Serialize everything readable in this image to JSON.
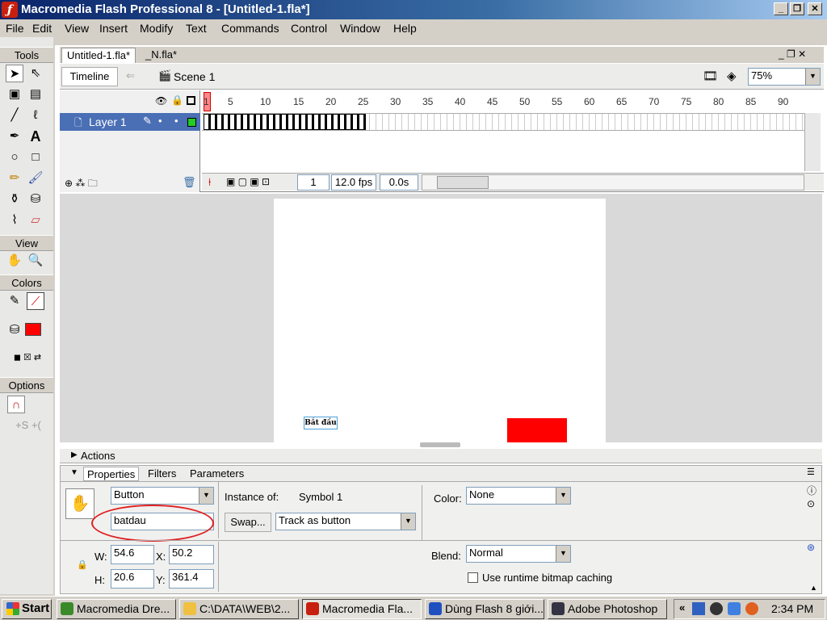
{
  "window": {
    "title": "Macromedia Flash Professional 8 - [Untitled-1.fla*]",
    "min": "_",
    "max": "❐",
    "close": "✕"
  },
  "menu": [
    "File",
    "Edit",
    "View",
    "Insert",
    "Modify",
    "Text",
    "Commands",
    "Control",
    "Window",
    "Help"
  ],
  "tools": {
    "header": "Tools",
    "view": "View",
    "colors": "Colors",
    "options": "Options"
  },
  "tabs": [
    "Untitled-1.fla*",
    "_N.fla*"
  ],
  "editbar": {
    "timeline": "Timeline",
    "scene": "Scene 1",
    "zoom": "75%"
  },
  "timeline": {
    "layer": "Layer 1",
    "ruler": [
      "1",
      "5",
      "10",
      "15",
      "20",
      "25",
      "30",
      "35",
      "40",
      "45",
      "50",
      "55",
      "60",
      "65",
      "70",
      "75",
      "80",
      "85",
      "90"
    ],
    "current_frame": "1",
    "fps": "12.0 fps",
    "time": "0.0s"
  },
  "stage": {
    "button_text": "Bắt đầu"
  },
  "panels": {
    "actions": "Actions",
    "properties": "Properties",
    "filters": "Filters",
    "parameters": "Parameters"
  },
  "properties": {
    "symbol_type": "Button",
    "instance_name": "batdau",
    "instance_of_label": "Instance of:",
    "instance_of": "Symbol 1",
    "swap": "Swap...",
    "track": "Track as button",
    "color_label": "Color:",
    "color": "None",
    "w_label": "W:",
    "w": "54.6",
    "h_label": "H:",
    "h": "20.6",
    "x_label": "X:",
    "x": "50.2",
    "y_label": "Y:",
    "y": "361.4",
    "blend_label": "Blend:",
    "blend": "Normal",
    "cache_label": "Use runtime bitmap caching"
  },
  "taskbar": {
    "start": "Start",
    "tasks": [
      "Macromedia Dre...",
      "C:\\DATA\\WEB\\2...",
      "Macromedia Fla...",
      "Dùng Flash 8 giới...",
      "Adobe Photoshop"
    ],
    "clock": "2:34 PM"
  },
  "colors": {
    "fill": "#ff0000",
    "title_start": "#0a246a",
    "title_end": "#a6caf0",
    "taskbar": "#d4d0c8",
    "highlight_circle": "#e02020"
  }
}
